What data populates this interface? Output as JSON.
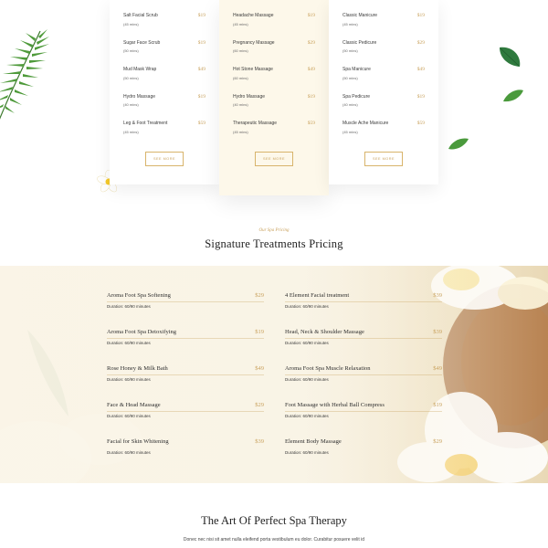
{
  "menu_cards": [
    {
      "items": [
        {
          "name": "Salt Facial Scrub",
          "duration": "(45 mins)",
          "price": "$19"
        },
        {
          "name": "Sugar Face Scrub",
          "duration": "(50 mins)",
          "price": "$19"
        },
        {
          "name": "Mud Mask Wrap",
          "duration": "(50 mins)",
          "price": "$49"
        },
        {
          "name": "Hydro Massage",
          "duration": "(40 mins)",
          "price": "$19"
        },
        {
          "name": "Leg & Foot Treatment",
          "duration": "(45 mins)",
          "price": "$59"
        }
      ],
      "button": "SEE MORE"
    },
    {
      "items": [
        {
          "name": "Headache Massage",
          "duration": "(45 mins)",
          "price": "$19"
        },
        {
          "name": "Pregnancy Massage",
          "duration": "(60 mins)",
          "price": "$29"
        },
        {
          "name": "Hot Stone Massage",
          "duration": "(60 mins)",
          "price": "$49"
        },
        {
          "name": "Hydro Massage",
          "duration": "(40 mins)",
          "price": "$19"
        },
        {
          "name": "Therapeutic Massage",
          "duration": "(45 mins)",
          "price": "$59"
        }
      ],
      "button": "SEE MORE"
    },
    {
      "items": [
        {
          "name": "Classic Manicure",
          "duration": "(45 mins)",
          "price": "$19"
        },
        {
          "name": "Classic Pedicure",
          "duration": "(50 mins)",
          "price": "$29"
        },
        {
          "name": "Spa Manicure",
          "duration": "(50 mins)",
          "price": "$49"
        },
        {
          "name": "Spa Pedicure",
          "duration": "(40 mins)",
          "price": "$19"
        },
        {
          "name": "Muscle Ache Manicure",
          "duration": "(45 mins)",
          "price": "$59"
        }
      ],
      "button": "SEE MORE"
    }
  ],
  "signature": {
    "kicker": "Our Spa Pricing",
    "title": "Signature Treatments Pricing",
    "left": [
      {
        "name": "Aroma Foot Spa Softening",
        "duration": "Duration: 60/90 minutes",
        "price": "$29"
      },
      {
        "name": "Aroma Foot Spa Detoxifying",
        "duration": "Duration: 60/90 minutes",
        "price": "$19"
      },
      {
        "name": "Rose Honey & Milk Bath",
        "duration": "Duration: 60/90 minutes",
        "price": "$49"
      },
      {
        "name": "Face & Head Massage",
        "duration": "Duration: 60/90 minutes",
        "price": "$29"
      },
      {
        "name": "Facial for Skin Whitening",
        "duration": "Duration: 60/90 minutes",
        "price": "$39"
      }
    ],
    "right": [
      {
        "name": "4 Element Facial treatment",
        "duration": "Duration: 60/90 minutes",
        "price": "$39"
      },
      {
        "name": "Head, Neck & Shoulder Massage",
        "duration": "Duration: 60/90 minutes",
        "price": "$39"
      },
      {
        "name": "Aroma Foot Spa Muscle Relaxation",
        "duration": "Duration: 60/90 minutes",
        "price": "$49"
      },
      {
        "name": "Foot Massage with Herbal Ball Compress",
        "duration": "Duration: 60/90 minutes",
        "price": "$19"
      },
      {
        "name": "Element Body Massage",
        "duration": "Duration: 60/90 minutes",
        "price": "$29"
      }
    ]
  },
  "art": {
    "title": "The Art Of Perfect Spa Therapy",
    "text": "Donec nec nisi sit amet nulla eleifend porta vestibulum eu dolor. Curabitur posuere velit id"
  },
  "colors": {
    "accent_gold": "#c9a25e",
    "leaf_green": "#3d8a3a",
    "highlight_card": "#fdf8ea",
    "band_cream": "#f6efde"
  },
  "icons": {
    "palm_leaf": "palm-leaf-icon",
    "flower": "plumeria-flower-icon",
    "leaf": "leaf-icon"
  }
}
